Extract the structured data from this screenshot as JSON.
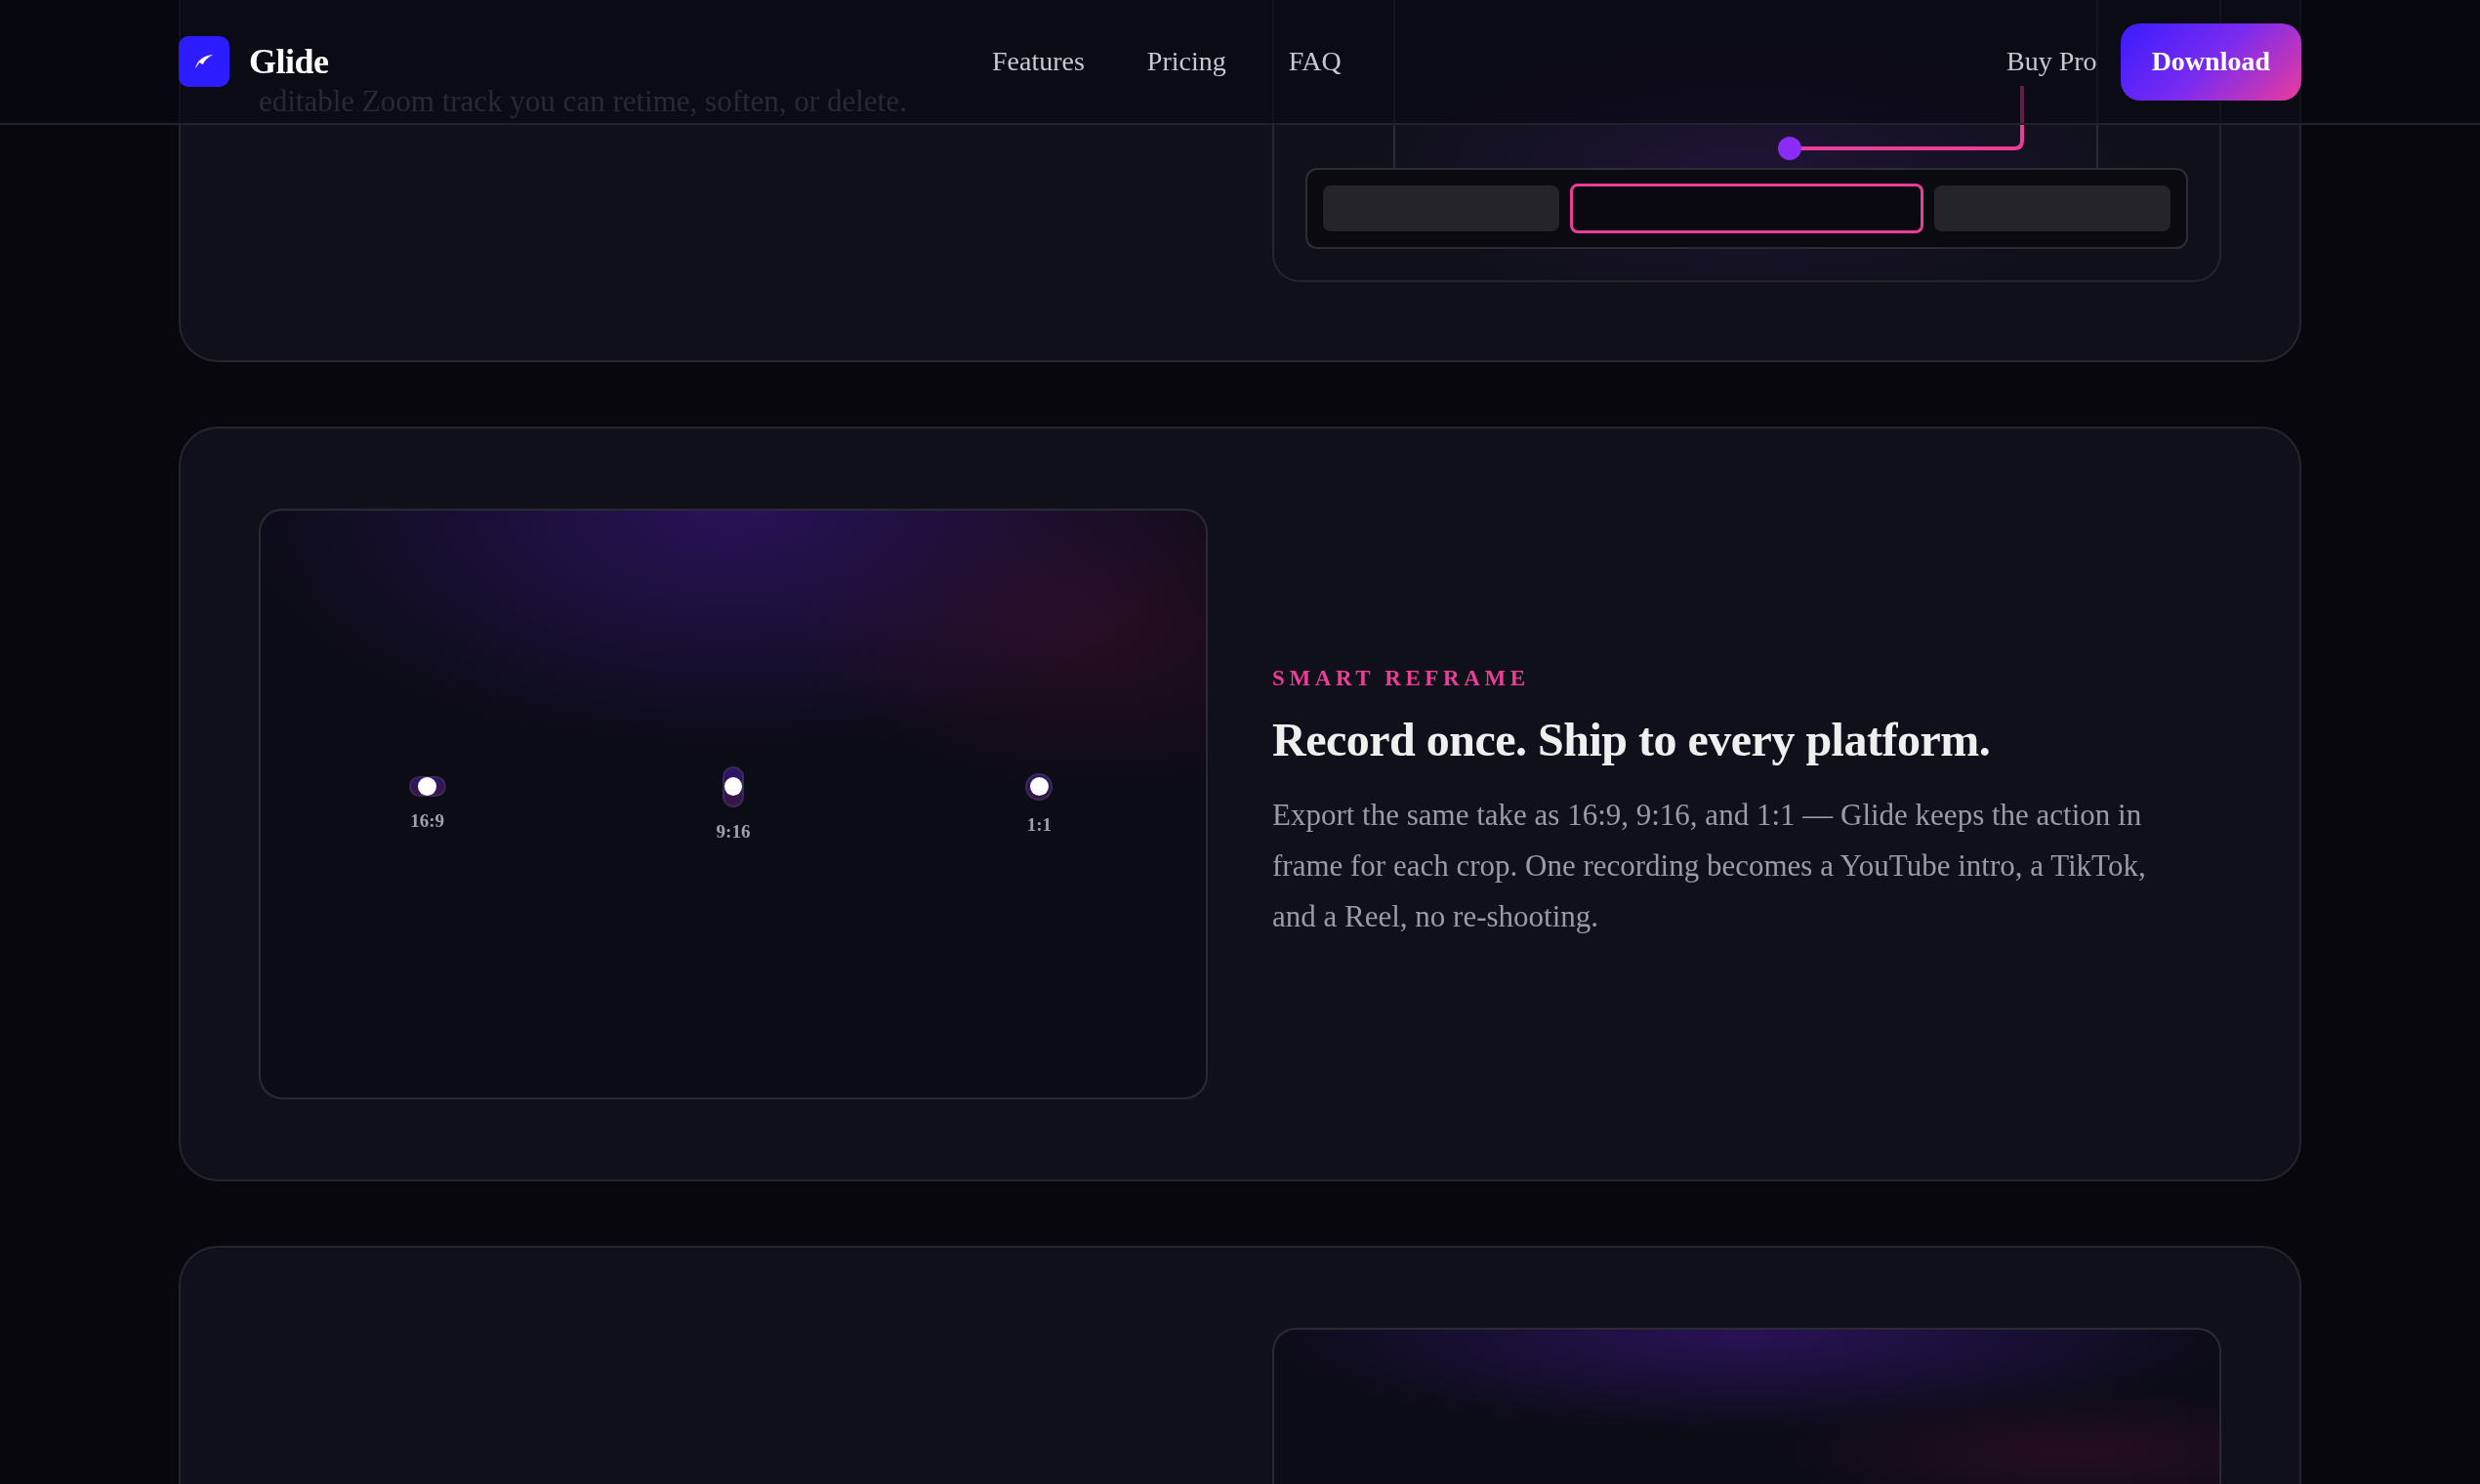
{
  "header": {
    "brand": "Glide",
    "nav": [
      {
        "label": "Features"
      },
      {
        "label": "Pricing"
      },
      {
        "label": "FAQ"
      }
    ],
    "buy_link": "Buy Pro",
    "download_button": "Download"
  },
  "zoom_card": {
    "caption": "editable Zoom track you can retime, soften, or delete."
  },
  "reframe_card": {
    "eyebrow": "SMART REFRAME",
    "title": "Record once. Ship to every platform.",
    "body": "Export the same take as 16:9, 9:16, and 1:1 — Glide keeps the action in frame for each crop. One recording becomes a YouTube intro, a TikTok, and a Reel, no re-shooting.",
    "formats": [
      {
        "label": "16:9",
        "kind": "wide"
      },
      {
        "label": "9:16",
        "kind": "tall"
      },
      {
        "label": "1:1",
        "kind": "square"
      }
    ]
  }
}
